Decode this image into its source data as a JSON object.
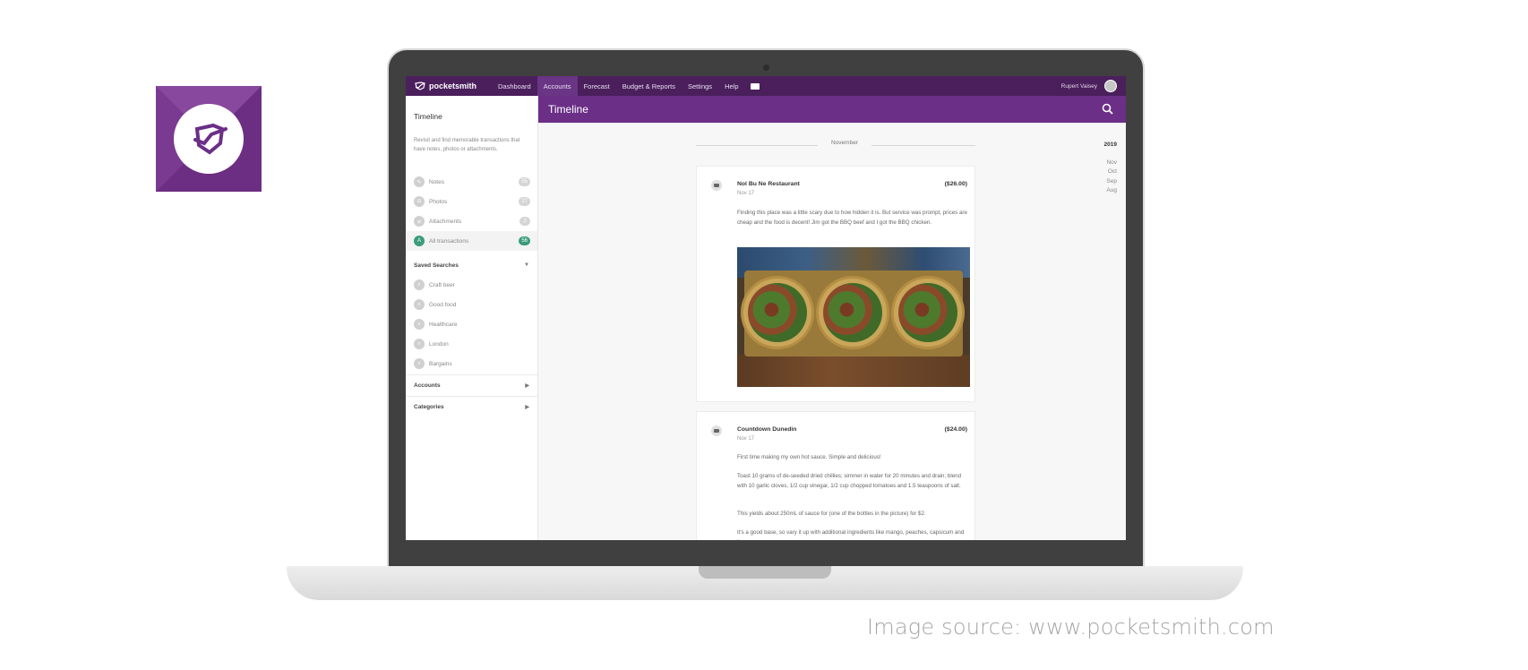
{
  "app_icon": {
    "name": "pocketsmith-logo-icon"
  },
  "caption": "Image source: www.pocketsmith.com",
  "nav": {
    "logo": "pocketsmith",
    "items": [
      "Dashboard",
      "Accounts",
      "Forecast",
      "Budget & Reports",
      "Settings",
      "Help"
    ],
    "active": "Accounts",
    "user": "Rupert Vaisey"
  },
  "page": {
    "title": "Timeline"
  },
  "sidebar": {
    "title": "Timeline",
    "description": "Revisit and find memorable transactions that have notes, photos or attachments.",
    "filters": [
      {
        "label": "Notes",
        "count": "55"
      },
      {
        "label": "Photos",
        "count": "27"
      },
      {
        "label": "Attachments",
        "count": "1"
      },
      {
        "label": "All transactions",
        "count": "56"
      }
    ],
    "saved_searches_label": "Saved Searches",
    "saved_searches": [
      "Craft beer",
      "Good food",
      "Healthcare",
      "London",
      "Bargains"
    ],
    "accounts_label": "Accounts",
    "categories_label": "Categories"
  },
  "timeline": {
    "month": "November",
    "year": "2019",
    "months": [
      "Nov",
      "Oct",
      "Sep",
      "Aug"
    ]
  },
  "transactions": [
    {
      "name": "Nol Bu Ne Restaurant",
      "date": "Nov 17",
      "amount": "($26.00)",
      "note": "Finding this place was a little scary due to how hidden it is. But service was prompt, prices are cheap and the food is decent! Jim got the BBQ beef and I got the BBQ chicken."
    },
    {
      "name": "Countdown Dunedin",
      "date": "Nov 17",
      "amount": "($24.00)",
      "note_1": "First time making my own hot sauce. Simple and delicious!",
      "note_2": "Toast 10 grams of de-seeded dried chillies; simmer in water for 20 minutes and drain; blend with 10 garlic cloves, 1/2 cup vinegar, 1/2 cup chopped tomatoes and 1.5 teaspoons of salt.",
      "note_3": "This yields about 250mL of sauce for (one of the bottles in the picture) for $2.",
      "note_4": "It's a good base, so vary it up with additional ingredients like mango, peaches, capsicum and lime."
    }
  ],
  "colors": {
    "nav_bg": "#4a1f5c",
    "title_bg": "#6b2f87",
    "accent_green": "#3a9c7a"
  }
}
